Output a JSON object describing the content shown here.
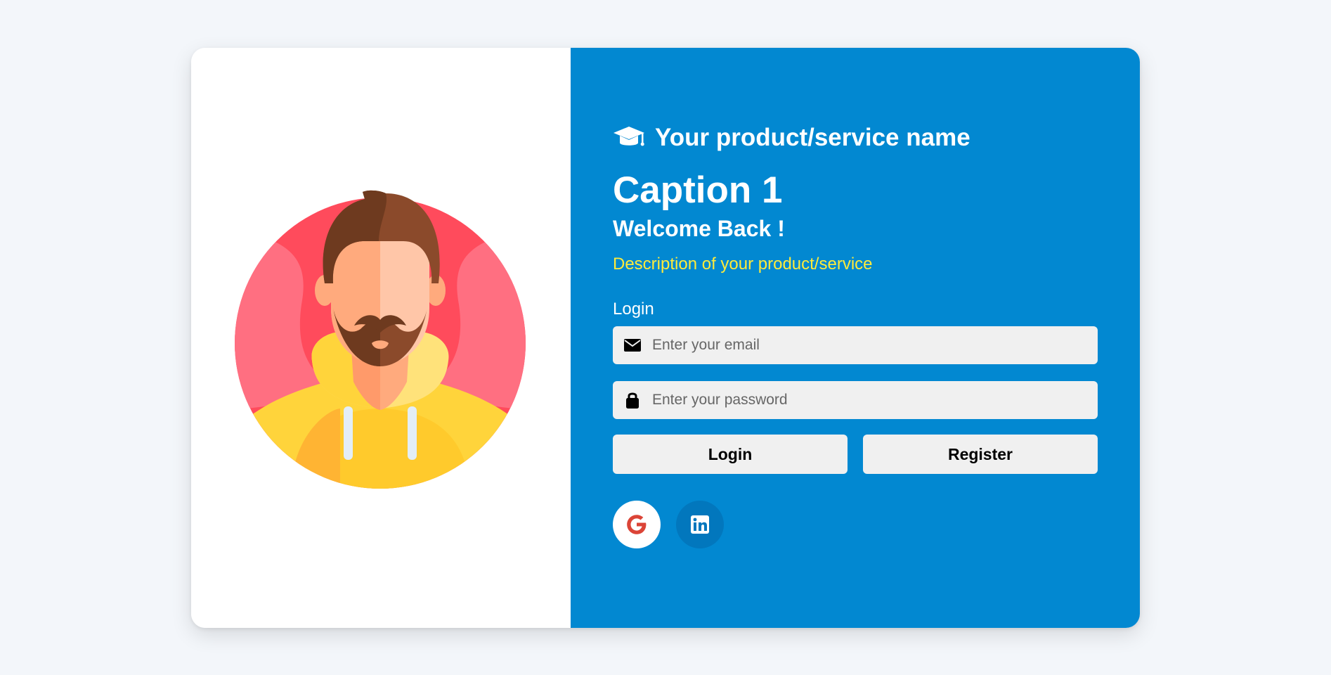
{
  "brand": {
    "icon": "graduation-cap-icon",
    "name": "Your product/service name"
  },
  "hero": {
    "caption": "Caption 1",
    "welcome": "Welcome Back !",
    "description": "Description of your product/service"
  },
  "login_form": {
    "label": "Login",
    "email": {
      "icon": "envelope-icon",
      "placeholder": "Enter your email",
      "value": ""
    },
    "password": {
      "icon": "lock-icon",
      "placeholder": "Enter your password",
      "value": ""
    },
    "login_button": "Login",
    "register_button": "Register"
  },
  "social_logins": [
    {
      "icon": "google-icon"
    },
    {
      "icon": "linkedin-icon"
    }
  ],
  "illustration": {
    "icon": "user-avatar-illustration"
  },
  "colors": {
    "page_background": "#f3f6fa",
    "panel_accent": "#0288d1",
    "description_text": "#ffeb3b",
    "button_background": "#f0f0f0",
    "google_red": "#db4437",
    "linkedin_button": "#0277bd"
  }
}
